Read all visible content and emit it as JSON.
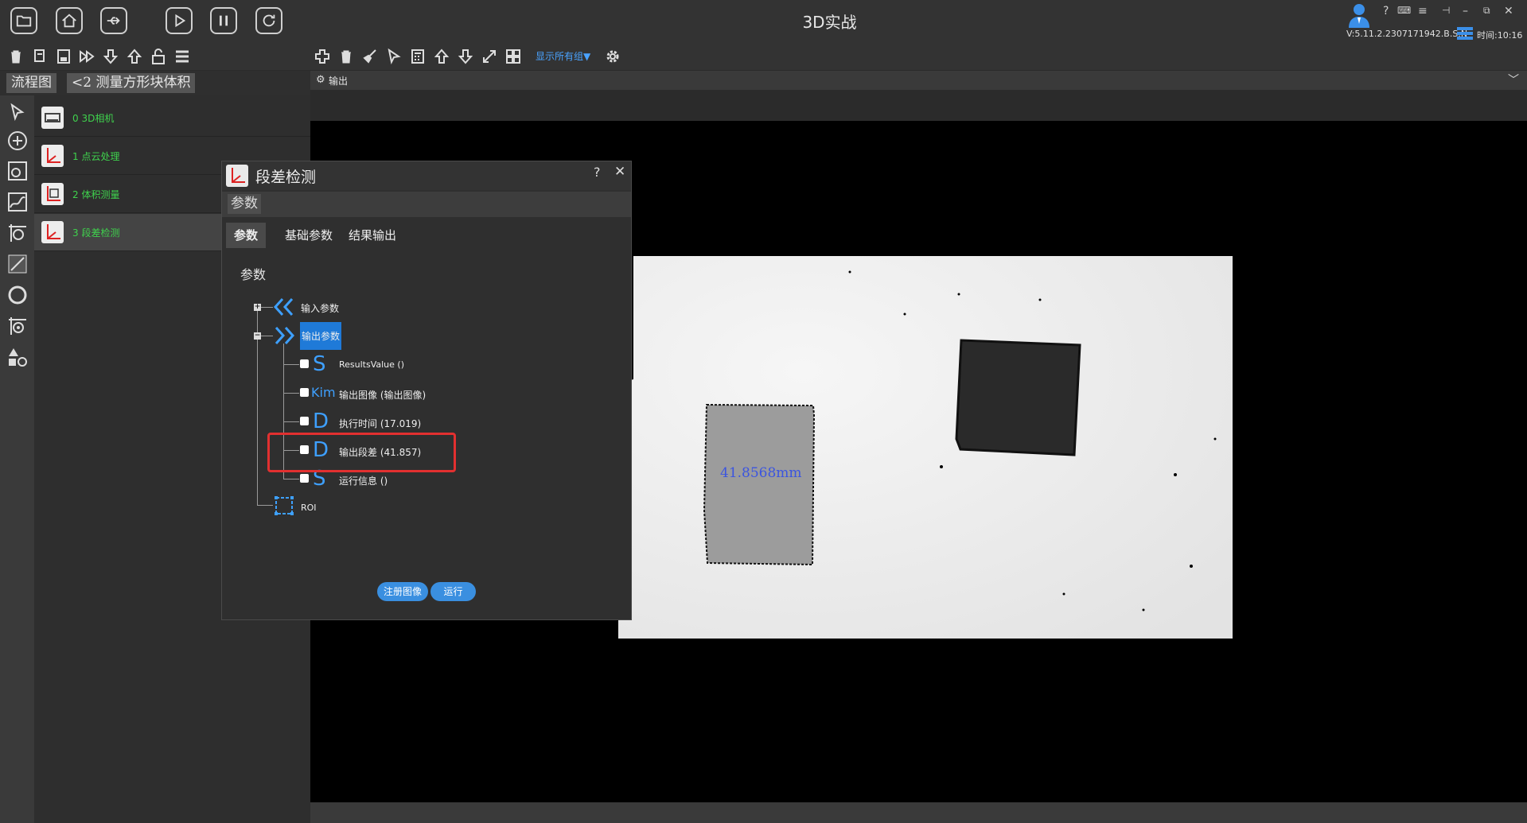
{
  "app": {
    "title": "3D实战",
    "version": "V:5.11.2.2307171942.B.S.N",
    "time": "时间:10:16"
  },
  "toolbar": {
    "show_groups": "显示所有组"
  },
  "tabs": {
    "flow": "流程图",
    "breadcrumb": "<2 测量方形块体积"
  },
  "flow": {
    "items": [
      {
        "label": "0 3D相机"
      },
      {
        "label": "1 点云处理"
      },
      {
        "label": "2 体积测量"
      },
      {
        "label": "3 段差检测"
      }
    ]
  },
  "output": {
    "title": "输出",
    "measurement": "41.8568mm"
  },
  "dialog": {
    "title": "段差检测",
    "help": "?",
    "close": "✕",
    "section": "参数",
    "tabs": [
      "参数",
      "基础参数",
      "结果输出"
    ],
    "subtitle": "参数",
    "tree": {
      "input": "输入参数",
      "output": "输出参数",
      "children": [
        {
          "glyph": "S",
          "label": "ResultsValue ()"
        },
        {
          "glyph": "Kim",
          "label": "输出图像 (输出图像)"
        },
        {
          "glyph": "D",
          "label": "执行时间 (17.019)"
        },
        {
          "glyph": "D",
          "label": "输出段差 (41.857)"
        },
        {
          "glyph": "S",
          "label": "运行信息 ()"
        }
      ],
      "roi": "ROI"
    },
    "buttons": {
      "register": "注册图像",
      "run": "运行"
    }
  }
}
